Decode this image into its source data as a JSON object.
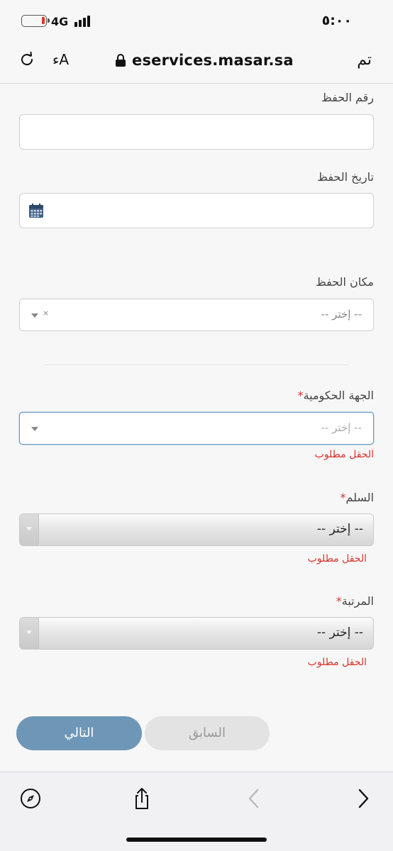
{
  "status_bar": {
    "network": "4G",
    "time": "٥:٠٠",
    "battery_level": 0.1
  },
  "browser": {
    "text_size": "ءA",
    "url": "eservices.masar.sa",
    "done": "تم"
  },
  "form": {
    "fields": {
      "save_number": {
        "label": "رقم الحفظ",
        "value": ""
      },
      "save_date": {
        "label": "تاريخ الحفظ",
        "value": ""
      },
      "save_place": {
        "label": "مكان الحفظ",
        "placeholder": "-- إختر --",
        "clear": "×"
      },
      "gov_entity": {
        "label": "الجهة الحكومية",
        "required": "*",
        "placeholder": "-- إختر --",
        "error": "الحقل مطلوب"
      },
      "ladder": {
        "label": "السلم",
        "required": "*",
        "value": "-- إختر --",
        "error": "الحقل مطلوب"
      },
      "rank": {
        "label": "المرتبة",
        "required": "*",
        "value": "-- إختر --",
        "error": "الحقل مطلوب"
      }
    },
    "buttons": {
      "next": "التالي",
      "previous": "السابق"
    }
  },
  "toolbar": {
    "icons": [
      "compass-icon",
      "share-icon",
      "back-arrow-icon",
      "forward-arrow-icon"
    ]
  },
  "colors": {
    "error": "#d9352b",
    "primary_button": "#6e97b7",
    "focus_border": "#6e9cc8"
  }
}
